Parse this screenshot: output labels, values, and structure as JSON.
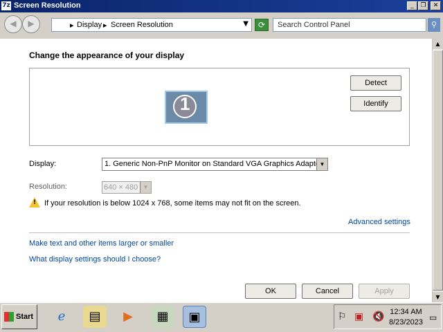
{
  "window": {
    "title": "Screen Resolution"
  },
  "address_bar": {
    "crumbs": [
      "Display",
      "Screen Resolution"
    ],
    "search_placeholder": "Search Control Panel"
  },
  "content": {
    "heading": "Change the appearance of your display",
    "monitor_number": "1",
    "detect_label": "Detect",
    "identify_label": "Identify",
    "display_label": "Display:",
    "display_value": "1. Generic Non-PnP Monitor on Standard VGA Graphics Adapter",
    "resolution_label": "Resolution:",
    "resolution_value": "640 × 480",
    "warning_text": "If your resolution is below 1024 x 768, some items may not fit on the screen.",
    "advanced_link": "Advanced settings",
    "link_text_size": "Make text and other items larger or smaller",
    "link_which_settings": "What display settings should I choose?"
  },
  "buttons": {
    "ok": "OK",
    "cancel": "Cancel",
    "apply": "Apply"
  },
  "taskbar": {
    "start_label": "Start",
    "clock_time": "12:34 AM",
    "clock_date": "8/23/2023"
  },
  "colors": {
    "titlebar": "#0a246a",
    "link": "#0046a0",
    "chrome": "#d4d0c8"
  }
}
